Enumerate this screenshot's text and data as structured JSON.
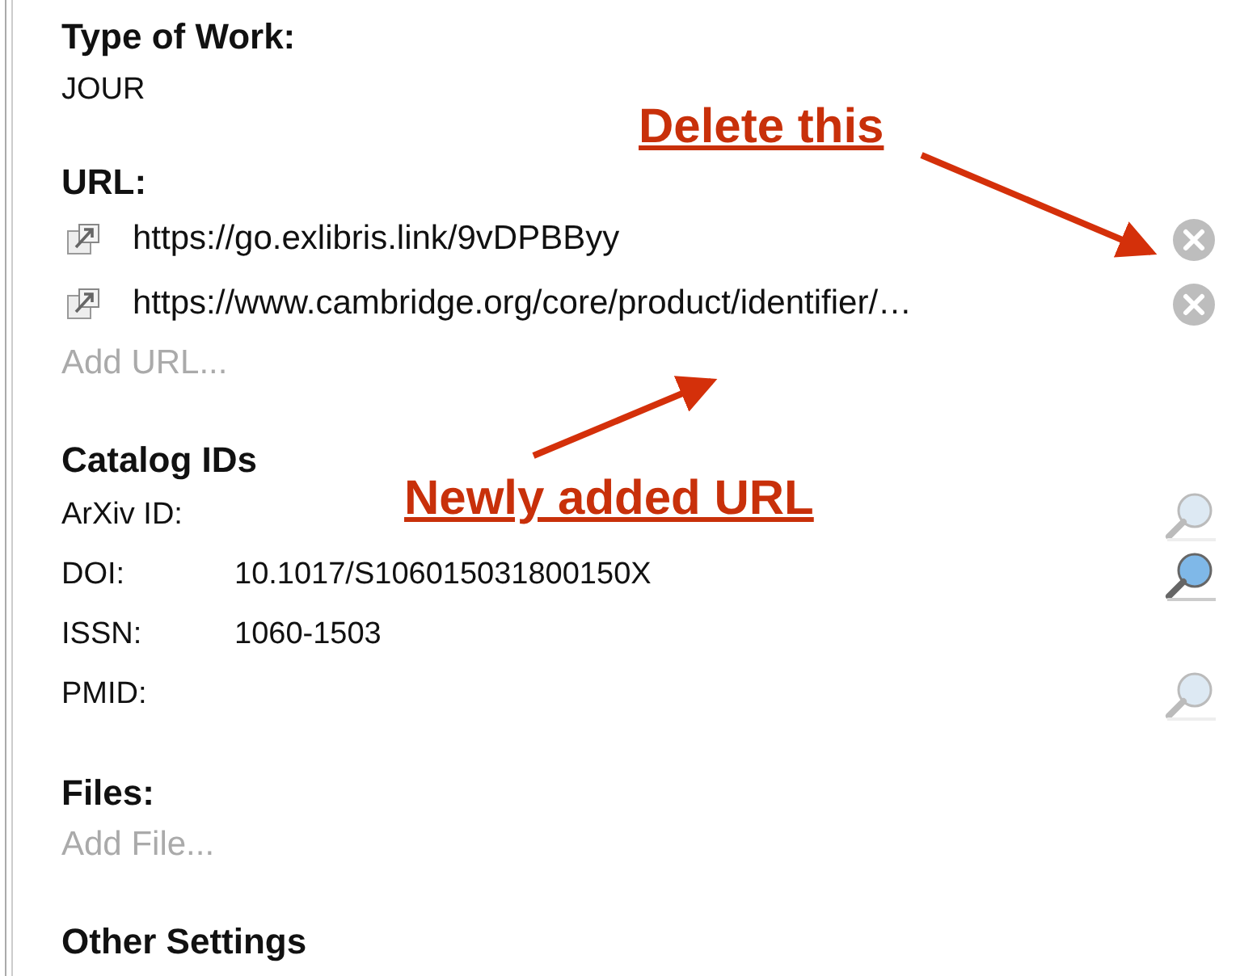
{
  "type_of_work": {
    "heading": "Type of Work:",
    "value": "JOUR"
  },
  "urls": {
    "heading": "URL:",
    "items": [
      {
        "url": "https://go.exlibris.link/9vDPBByy"
      },
      {
        "url": "https://www.cambridge.org/core/product/identifier/…"
      }
    ],
    "add_placeholder": "Add URL..."
  },
  "catalog_ids": {
    "heading": "Catalog IDs",
    "rows": [
      {
        "label": "ArXiv ID:",
        "lookup_enabled": false
      },
      {
        "label": "DOI:",
        "value": "10.1017/S106015031800150X",
        "lookup_enabled": true
      },
      {
        "label": "ISSN:",
        "value": "1060-1503"
      },
      {
        "label": "PMID:",
        "lookup_enabled": false
      }
    ]
  },
  "files": {
    "heading": "Files:",
    "add_placeholder": "Add File..."
  },
  "other_settings": {
    "heading": "Other Settings"
  },
  "annotations": [
    {
      "text": "Delete this",
      "kind": "upper"
    },
    {
      "text": "Newly added URL",
      "kind": "lower"
    }
  ]
}
